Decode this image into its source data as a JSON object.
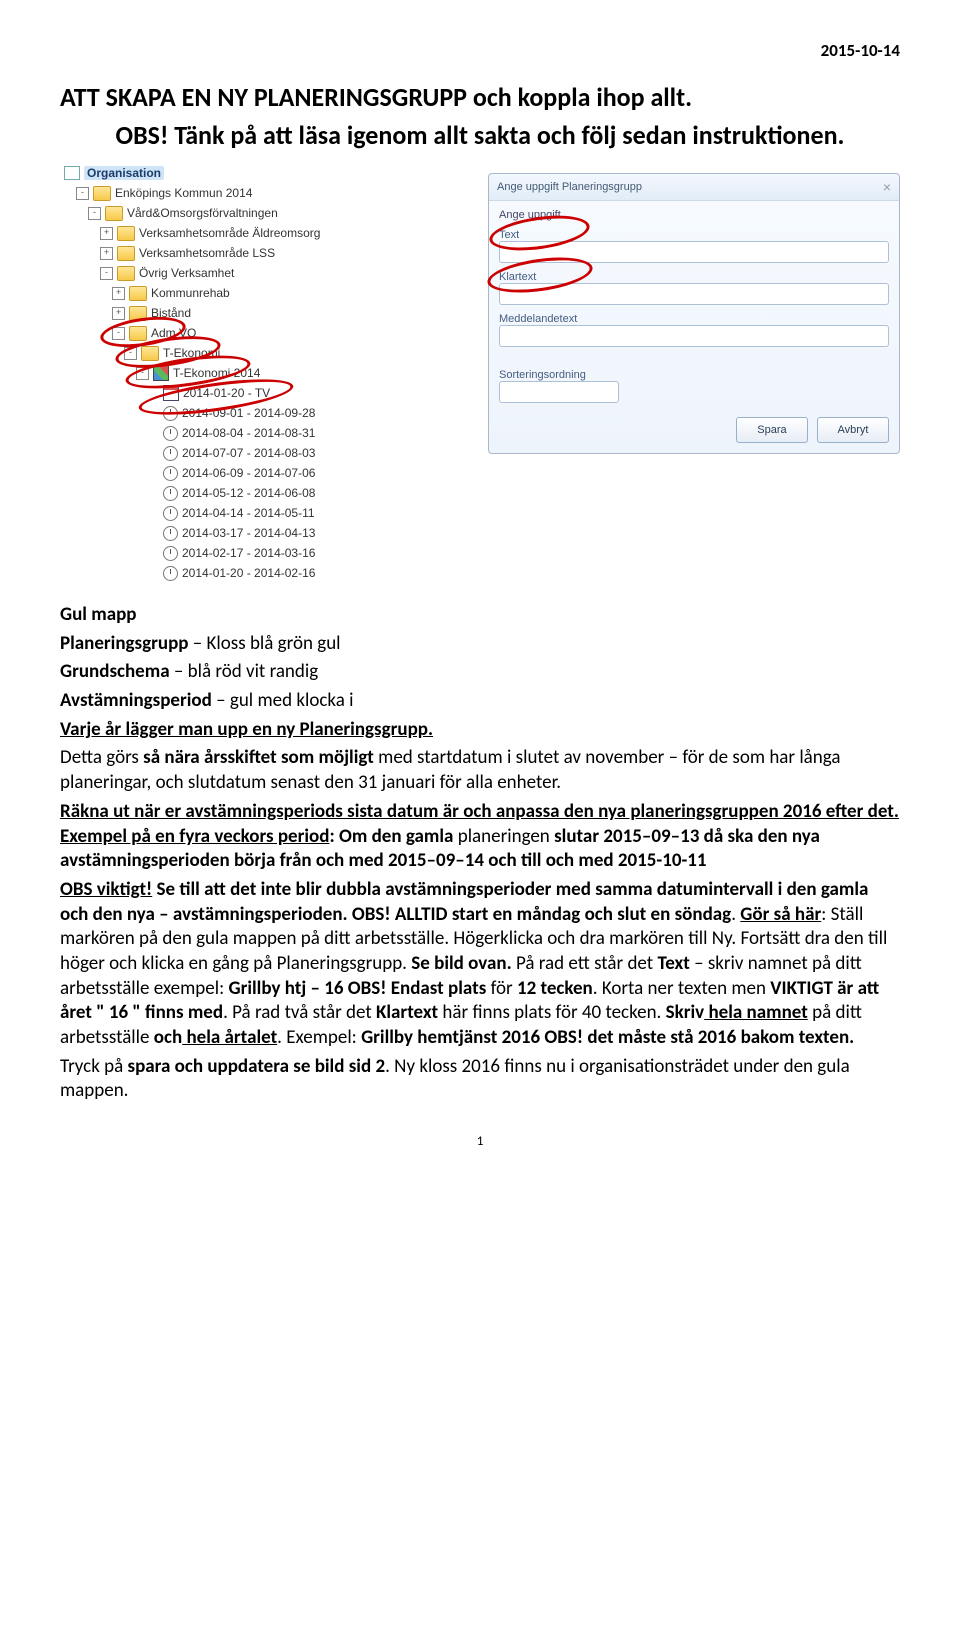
{
  "date_top": "2015-10-14",
  "heading": "ATT SKAPA EN NY PLANERINGSGRUPP och koppla ihop allt.",
  "subhead": "OBS! Tänk på att läsa igenom allt sakta och följ sedan instruktionen.",
  "tree": {
    "root": "Organisation",
    "items": [
      "Enköpings Kommun 2014",
      "Vård&Omsorgsförvaltningen",
      "Verksamhetsområde Äldreomsorg",
      "Verksamhetsområde LSS",
      "Övrig Verksamhet",
      "Kommunrehab",
      "Bistånd",
      "Adm VO",
      "T-Ekonomi",
      "T-Ekonomi 2014",
      "2014-01-20 - TV",
      "2014-09-01 - 2014-09-28",
      "2014-08-04 - 2014-08-31",
      "2014-07-07 - 2014-08-03",
      "2014-06-09 - 2014-07-06",
      "2014-05-12 - 2014-06-08",
      "2014-04-14 - 2014-05-11",
      "2014-03-17 - 2014-04-13",
      "2014-02-17 - 2014-03-16",
      "2014-01-20 - 2014-02-16"
    ]
  },
  "panel": {
    "title": "Ange uppgift Planeringsgrupp",
    "group": "Ange uppgift",
    "f1": "Text",
    "f2": "Klartext",
    "f3": "Meddelandetext",
    "f4": "Sorteringsordning",
    "save": "Spara",
    "cancel": "Avbryt"
  },
  "para": {
    "l1": "Gul mapp",
    "l2a": "Planeringsgrupp",
    "l2b": " – Kloss blå grön gul",
    "l3a": "Grundschema",
    "l3b": " – blå röd vit randig",
    "l4a": "Avstämningsperiod",
    "l4b": " – gul med klocka i",
    "l5": "Varje år lägger man upp en ny Planeringsgrupp.",
    "l6a": "Detta görs ",
    "l6b": "så nära årsskiftet som möjligt",
    "l6c": " med startdatum i slutet av november – för de som har långa planeringar, och slutdatum senast den 31 januari för alla enheter.",
    "l7a": "Räkna ut när er avstämningsperiods sista datum är och anpassa den nya planeringsgruppen 2016 efter det.",
    "l7b": " Exempel på en fyra veckors period",
    "l7c": ": Om den ",
    "l7d": "gamla",
    "l7e": " planeringen ",
    "l7f": "slutar",
    "l7g": " 2015–09–13 ",
    "l7h": "då ska den nya avstämningsperioden börja från och med",
    "l7i": " 2015–09–14 ",
    "l7j": "och till och med 2015-10-11",
    "l8a": "OBS viktigt!",
    "l8b": " Se till att det inte blir dubbla avstämningsperioder med samma datumintervall i den gamla och den nya – avstämningsperioden. OBS! ALLTID start en måndag och slut en söndag",
    "l8c": ". ",
    "l8d": "Gör så här",
    "l8e": ": Ställ markören på den gula mappen på ditt arbetsställe. Högerklicka och dra markören till Ny. Fortsätt dra den till höger och klicka en gång på Planeringsgrupp. ",
    "l8f": "Se bild ovan.",
    "l8g": " På rad ett står det ",
    "l8h": "Text",
    "l8i": " – skriv namnet på ditt arbetsställe exempel: ",
    "l8j": "Grillby htj – 16 OBS!",
    "l8k": " Endast plats",
    "l8l": " för ",
    "l8m": "12 tecken",
    "l8n": ". Korta ner texten men ",
    "l8o": "VIKTIGT är att året \" 16 \" finns med",
    "l8p": ". På rad två står det ",
    "l8q": "Klartext",
    "l8r": " här finns plats för 40 tecken. ",
    "l8s": "Skriv",
    "l8t": " hela namnet",
    "l8u": " på ditt arbetsställe ",
    "l8v": "och",
    "l8w": " hela årtalet",
    "l8x": ". Exempel: ",
    "l8y": "Grillby hemtjänst 2016 OBS! det måste stå 2016 bakom texten.",
    "l9a": "Tryck på ",
    "l9b": "spara och uppdatera se bild sid 2",
    "l9c": ". Ny kloss 2016 finns nu i organisationsträdet under den gula mappen."
  },
  "pagenum": "1"
}
